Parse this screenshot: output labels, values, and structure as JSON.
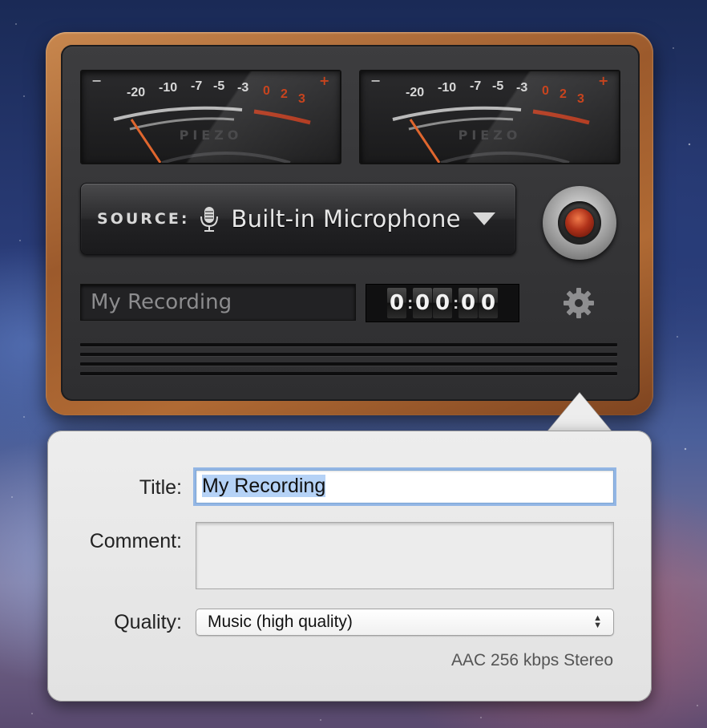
{
  "meter": {
    "scale_labels": [
      "-20",
      "-10",
      "-7",
      "-5",
      "-3",
      "0",
      "2",
      "3"
    ],
    "minus": "−",
    "plus": "+",
    "brand": "PIEZO"
  },
  "source": {
    "label": "SOURCE:",
    "value": "Built-in Microphone"
  },
  "recording": {
    "title": "My Recording",
    "timer_digits": [
      "0",
      "0",
      "0",
      "0",
      "0"
    ],
    "timer_sep": ":"
  },
  "form": {
    "title_label": "Title:",
    "title_value": "My Recording",
    "comment_label": "Comment:",
    "comment_value": "",
    "quality_label": "Quality:",
    "quality_value": "Music (high quality)",
    "format_info": "AAC 256 kbps Stereo"
  },
  "colors": {
    "wood": "#9c5a2c",
    "needle": "#e0662e",
    "red_zone": "#c8441e",
    "selection": "#b5d2f6"
  }
}
